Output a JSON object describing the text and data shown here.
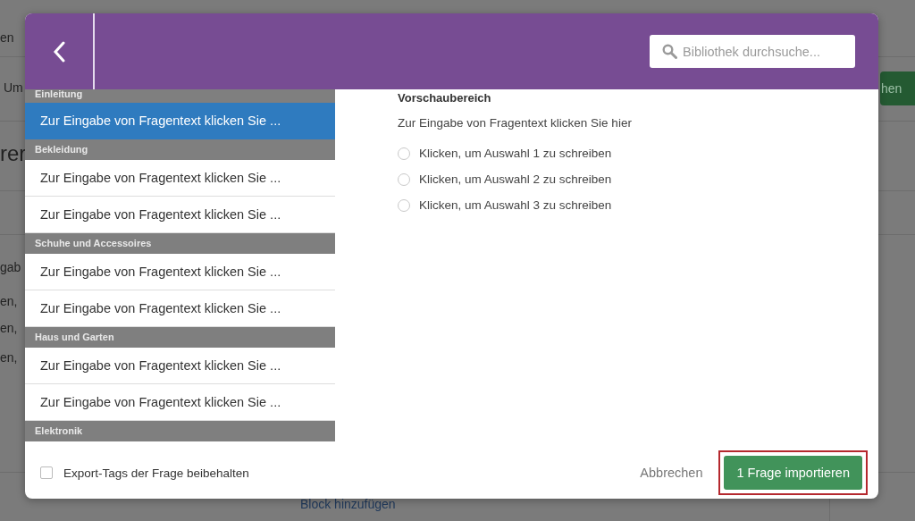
{
  "background_page": {
    "fragments": [
      {
        "kind": "tab",
        "text": "en"
      },
      {
        "kind": "label",
        "text": "Um"
      },
      {
        "kind": "button",
        "text": "hen"
      },
      {
        "kind": "heading",
        "text": "rer"
      },
      {
        "kind": "label",
        "text": "gab"
      },
      {
        "kind": "label",
        "text": "en,"
      },
      {
        "kind": "label",
        "text": "en,"
      },
      {
        "kind": "label",
        "text": "en,"
      },
      {
        "kind": "link",
        "text": "Block hinzufügen"
      }
    ]
  },
  "dialog": {
    "search": {
      "placeholder": "Bibliothek durchsuche..."
    },
    "library": [
      {
        "category": "Einleitung",
        "questions": [
          {
            "text": "Zur Eingabe von Fragentext klicken Sie ...",
            "selected": true
          }
        ]
      },
      {
        "category": "Bekleidung",
        "questions": [
          {
            "text": "Zur Eingabe von Fragentext klicken Sie ...",
            "selected": false
          },
          {
            "text": "Zur Eingabe von Fragentext klicken Sie ...",
            "selected": false
          }
        ]
      },
      {
        "category": "Schuhe und Accessoires",
        "questions": [
          {
            "text": "Zur Eingabe von Fragentext klicken Sie ...",
            "selected": false
          },
          {
            "text": "Zur Eingabe von Fragentext klicken Sie ...",
            "selected": false
          }
        ]
      },
      {
        "category": "Haus und Garten",
        "questions": [
          {
            "text": "Zur Eingabe von Fragentext klicken Sie ...",
            "selected": false
          },
          {
            "text": "Zur Eingabe von Fragentext klicken Sie ...",
            "selected": false
          }
        ]
      },
      {
        "category": "Elektronik"
      }
    ],
    "preview": {
      "title": "Vorschaubereich",
      "question": "Zur Eingabe von Fragentext klicken Sie hier",
      "choices": [
        {
          "label": "Klicken, um Auswahl 1 zu schreiben",
          "selected": false
        },
        {
          "label": "Klicken, um Auswahl 2 zu schreiben",
          "selected": false
        },
        {
          "label": "Klicken, um Auswahl 3 zu schreiben",
          "selected": false
        }
      ]
    },
    "keep_export_tags": {
      "label": "Export-Tags der Frage beibehalten",
      "checked": false
    },
    "cancel": "Abbrechen",
    "import": {
      "label": "1 Frage importieren",
      "highlighted": true
    }
  }
}
